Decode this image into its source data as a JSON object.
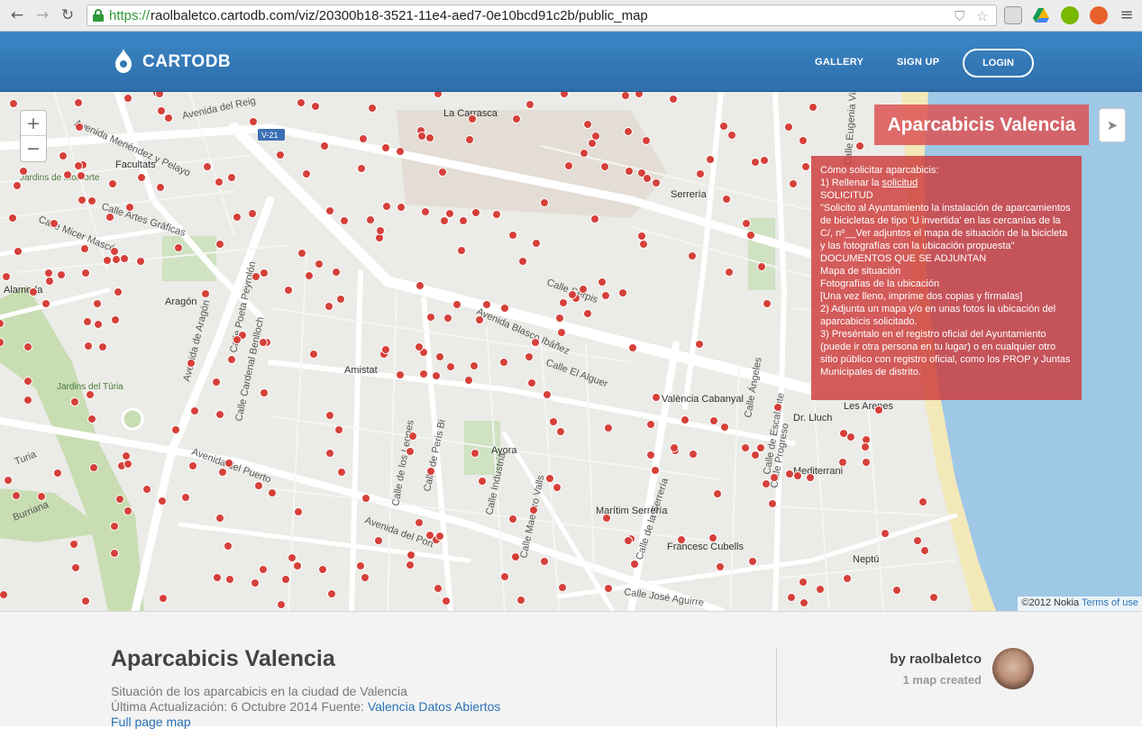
{
  "browser": {
    "url_scheme": "https://",
    "url_rest": "raolbaletco.cartodb.com/viz/20300b18-3521-11e4-aed7-0e10bcd91c2b/public_map",
    "back_icon": "back-arrow-icon",
    "forward_icon": "forward-arrow-icon",
    "reload_icon": "reload-icon"
  },
  "header": {
    "logo_text": "CARTODB",
    "links": [
      "GALLERY",
      "SIGN UP"
    ],
    "login_label": "LOGIN"
  },
  "map": {
    "zoom_in": "+",
    "zoom_out": "−",
    "title": "Aparcabicis Valencia",
    "share_icon": "paper-plane-icon",
    "info_lines": [
      "Cómo solicitar aparcabicis:",
      "1) Rellenar la ",
      "solicitud",
      "SOLICITUD",
      "\"Solicito al Ayuntamiento la instalación de aparcamientos de bicicletas de tipo 'U invertida' en las cercanías de la C/, nº__Ver adjuntos el mapa de situación de la bicicleta y las fotografías con la ubicación propuesta\"",
      "DOCUMENTOS QUE SE ADJUNTAN",
      "Mapa de situación",
      "Fotografías de la ubicación",
      "[Una vez lleno, imprime dos copias y fírmalas]",
      "2) Adjunta un mapa y/o en unas fotos la ubicación del aparcabicis solicitado.",
      "3) Preséntalo en el registro oficial del Ayuntamiento (puede ir otra persona en tu lugar) o en cualquier otro sitio público con registro oficial, como los PROP y Juntas Municipales de distrito."
    ],
    "attribution": "©2012 Nokia",
    "attribution_link": "Terms of use",
    "labels": [
      "La Carrasca",
      "Serrería",
      "Facultats",
      "Jardins de Monforte",
      "Alameda",
      "Aragón",
      "Amistat",
      "Jardins del Túria",
      "València Cabanyal",
      "Les Arenes",
      "Dr. Lluch",
      "Mediterrani",
      "Ayora",
      "Marítim Serrería",
      "Francesc Cubells",
      "Neptú",
      "Avenida Menéndez y Pelayo",
      "Calle Micer Mascó",
      "Calle Artes Gráficas",
      "Avenida de Aragón",
      "Calle Cardenal Benlloch",
      "Calle Poeta Peyrolón",
      "Calle Serpis",
      "Avenida Blasco Ibáñez",
      "Calle El Alguer",
      "Avenida del Puerto",
      "Calle de Peris Bi",
      "Calle Industria",
      "Calle de los Leones",
      "Calle de la Serrería",
      "Calle Ángeles",
      "Calle de Escalante",
      "Calle Progreso",
      "Calle José Aguirre",
      "Calle Maestro Valls",
      "Avenida del Port",
      "Turia",
      "Burriana",
      "Avenida del Reig",
      "V-21",
      "Calle Eugenia Viñes"
    ]
  },
  "footer": {
    "title": "Aparcabicis Valencia",
    "description": "Situación de los aparcabicis en la ciudad de Valencia",
    "update_prefix": "Última Actualización: 6 Octubre 2014 Fuente: ",
    "source_link": "Valencia Datos Abiertos",
    "full_page": "Full page map",
    "by": "by raolbaletco",
    "maps_created": "1 map created"
  }
}
